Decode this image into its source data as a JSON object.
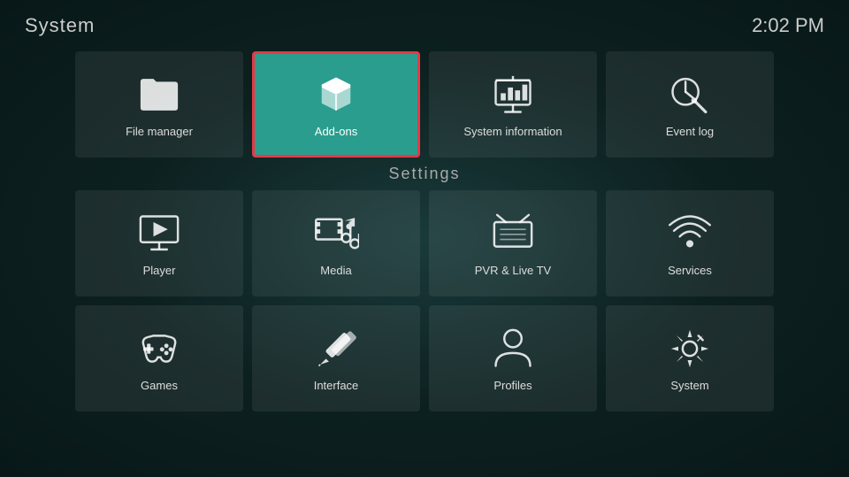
{
  "header": {
    "title": "System",
    "time": "2:02 PM"
  },
  "settings_label": "Settings",
  "top_tiles": [
    {
      "id": "file-manager",
      "label": "File manager",
      "icon": "folder"
    },
    {
      "id": "add-ons",
      "label": "Add-ons",
      "icon": "addons",
      "active": true
    },
    {
      "id": "system-information",
      "label": "System information",
      "icon": "system-info"
    },
    {
      "id": "event-log",
      "label": "Event log",
      "icon": "event-log"
    }
  ],
  "bottom_rows": [
    [
      {
        "id": "player",
        "label": "Player",
        "icon": "player"
      },
      {
        "id": "media",
        "label": "Media",
        "icon": "media"
      },
      {
        "id": "pvr-live-tv",
        "label": "PVR & Live TV",
        "icon": "pvr"
      },
      {
        "id": "services",
        "label": "Services",
        "icon": "services"
      }
    ],
    [
      {
        "id": "games",
        "label": "Games",
        "icon": "games"
      },
      {
        "id": "interface",
        "label": "Interface",
        "icon": "interface"
      },
      {
        "id": "profiles",
        "label": "Profiles",
        "icon": "profiles"
      },
      {
        "id": "system",
        "label": "System",
        "icon": "system-settings"
      }
    ]
  ]
}
